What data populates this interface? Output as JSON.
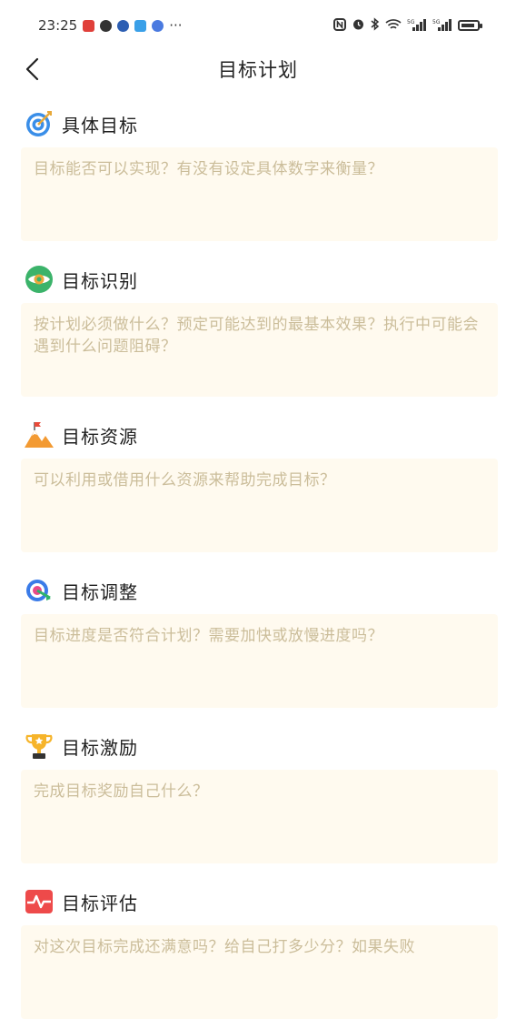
{
  "status_bar": {
    "time": "23:25",
    "more": "···",
    "left_icons": [
      "app-icon",
      "message-icon",
      "app-icon",
      "app-icon",
      "app-icon"
    ],
    "right_icons": [
      "nfc-icon",
      "alarm-icon",
      "bluetooth-icon",
      "wifi-icon",
      "signal-icon",
      "signal-icon",
      "battery-icon"
    ]
  },
  "nav": {
    "title": "目标计划"
  },
  "sections": [
    {
      "title": "具体目标",
      "placeholder": "目标能否可以实现？有没有设定具体数字来衡量？",
      "icon": "target-icon"
    },
    {
      "title": "目标识别",
      "placeholder": "按计划必须做什么？预定可能达到的最基本效果？执行中可能会遇到什么问题阻碍？",
      "icon": "eye-target-icon"
    },
    {
      "title": "目标资源",
      "placeholder": "可以利用或借用什么资源来帮助完成目标？",
      "icon": "mountain-flag-icon"
    },
    {
      "title": "目标调整",
      "placeholder": "目标进度是否符合计划？需要加快或放慢进度吗？",
      "icon": "aim-adjust-icon"
    },
    {
      "title": "目标激励",
      "placeholder": "完成目标奖励自己什么？",
      "icon": "trophy-icon"
    },
    {
      "title": "目标评估",
      "placeholder": "对这次目标完成还满意吗？给自己打多少分？如果失败",
      "icon": "pulse-chart-icon"
    }
  ]
}
